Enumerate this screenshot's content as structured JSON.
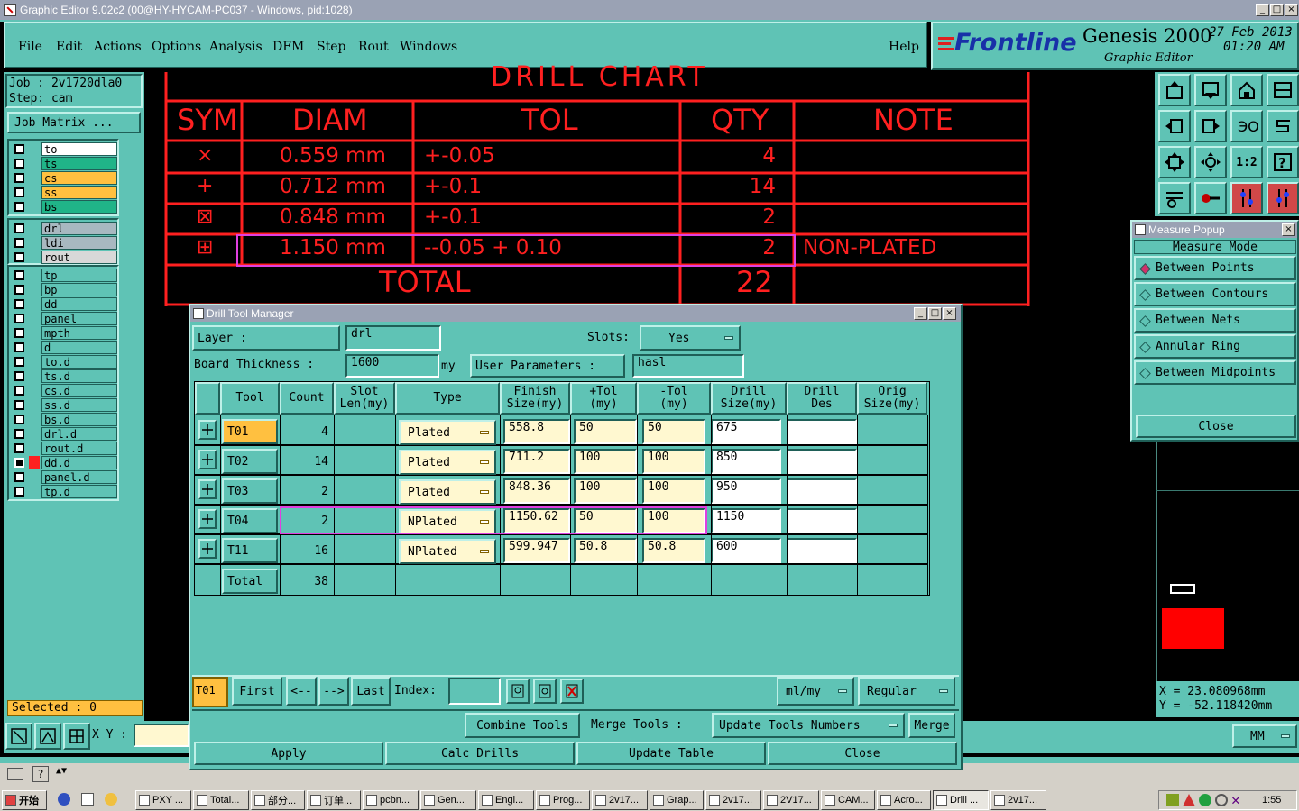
{
  "window": {
    "title": "Graphic Editor 9.02c2 (00@HY-HYCAM-PC037 - Windows, pid:1028)"
  },
  "menu": [
    "File",
    "Edit",
    "Actions",
    "Options",
    "Analysis",
    "DFM",
    "Step",
    "Rout",
    "Windows"
  ],
  "help": "Help",
  "brand": {
    "logo": "Frontline",
    "product": "Genesis 2000",
    "subtitle": "Graphic Editor",
    "date": "27 Feb 2013",
    "time": "01:20 AM"
  },
  "job": {
    "job_label": "Job : 2v1720dla0",
    "step_label": "Step: cam",
    "matrix_button": "Job Matrix ..."
  },
  "layers": {
    "group1": [
      {
        "name": "to",
        "color": "#ffffff"
      },
      {
        "name": "ts",
        "color": "#20b488"
      },
      {
        "name": "cs",
        "color": "#ffc040"
      },
      {
        "name": "ss",
        "color": "#ffc040"
      },
      {
        "name": "bs",
        "color": "#20b488"
      }
    ],
    "group2": [
      {
        "name": "drl",
        "color": "#a8b8c0"
      },
      {
        "name": "ldi",
        "color": "#a8b8c0"
      },
      {
        "name": "rout",
        "color": "#d8d8d8"
      }
    ],
    "group3": [
      {
        "name": "tp"
      },
      {
        "name": "bp"
      },
      {
        "name": "dd"
      },
      {
        "name": "panel"
      },
      {
        "name": "mpth"
      },
      {
        "name": "d"
      },
      {
        "name": "to.d"
      },
      {
        "name": "ts.d"
      },
      {
        "name": "cs.d"
      },
      {
        "name": "ss.d"
      },
      {
        "name": "bs.d"
      },
      {
        "name": "drl.d"
      },
      {
        "name": "rout.d"
      },
      {
        "name": "dd.d"
      },
      {
        "name": "panel.d"
      },
      {
        "name": "tp.d"
      }
    ],
    "selected_label": "Selected : 0"
  },
  "drill_chart": {
    "title": "DRILL CHART",
    "headers": [
      "SYM",
      "DIAM",
      "TOL",
      "QTY",
      "NOTE"
    ],
    "rows": [
      {
        "sym": "×",
        "diam": "0.559 mm",
        "tol": "+-0.05",
        "qty": "4",
        "note": ""
      },
      {
        "sym": "+",
        "diam": "0.712 mm",
        "tol": "+-0.1",
        "qty": "14",
        "note": ""
      },
      {
        "sym": "⊠",
        "diam": "0.848 mm",
        "tol": "+-0.1",
        "qty": "2",
        "note": ""
      },
      {
        "sym": "⊞",
        "diam": "1.150 mm",
        "tol": "--0.05 + 0.10",
        "qty": "2",
        "note": "NON-PLATED"
      }
    ],
    "total_label": "TOTAL",
    "total_qty": "22"
  },
  "measure_popup": {
    "title": "Measure Popup",
    "mode_label": "Measure Mode",
    "options": [
      {
        "label": "Between Points",
        "selected": true
      },
      {
        "label": "Between Contours",
        "selected": false
      },
      {
        "label": "Between Nets",
        "selected": false
      },
      {
        "label": "Annular Ring",
        "selected": false
      },
      {
        "label": "Between Midpoints",
        "selected": false
      }
    ],
    "close": "Close"
  },
  "coords": {
    "x": "X  = 23.080968mm",
    "y": "Y  = -52.118420mm"
  },
  "dtm": {
    "title": "Drill Tool Manager",
    "layer_label": "Layer          :",
    "layer_value": "drl",
    "slots_label": "Slots:",
    "slots_value": "Yes",
    "thickness_label": "Board Thickness :",
    "thickness_value": "1600",
    "thickness_unit": "my",
    "user_params_label": "User Parameters :",
    "user_params_value": "hasl",
    "columns": [
      {
        "id": "tool",
        "label": "Tool"
      },
      {
        "id": "count",
        "label": "Count"
      },
      {
        "id": "slot",
        "label": "Slot\nLen(my)"
      },
      {
        "id": "type",
        "label": "Type"
      },
      {
        "id": "finish",
        "label": "Finish\nSize(my)"
      },
      {
        "id": "ptol",
        "label": "+Tol\n(my)"
      },
      {
        "id": "mtol",
        "label": "-Tol\n(my)"
      },
      {
        "id": "drill",
        "label": "Drill\nSize(my)"
      },
      {
        "id": "des",
        "label": "Drill\nDes"
      },
      {
        "id": "orig",
        "label": "Orig\nSize(my)"
      }
    ],
    "rows": [
      {
        "tool": "T01",
        "count": "4",
        "type": "Plated",
        "finish": "558.8",
        "ptol": "50",
        "mtol": "50",
        "drill": "675",
        "des": ""
      },
      {
        "tool": "T02",
        "count": "14",
        "type": "Plated",
        "finish": "711.2",
        "ptol": "100",
        "mtol": "100",
        "drill": "850",
        "des": ""
      },
      {
        "tool": "T03",
        "count": "2",
        "type": "Plated",
        "finish": "848.36",
        "ptol": "100",
        "mtol": "100",
        "drill": "950",
        "des": ""
      },
      {
        "tool": "T04",
        "count": "2",
        "type": "NPlated",
        "finish": "1150.62",
        "ptol": "50",
        "mtol": "100",
        "drill": "1150",
        "des": ""
      },
      {
        "tool": "T11",
        "count": "16",
        "type": "NPlated",
        "finish": "599.947",
        "ptol": "50.8",
        "mtol": "50.8",
        "drill": "600",
        "des": ""
      }
    ],
    "total_label": "Total",
    "total_count": "38",
    "nav": {
      "current": "T01",
      "first": "First",
      "prev": "<--",
      "next": "-->",
      "last": "Last",
      "index_label": "Index:",
      "units": "ml/my",
      "mode": "Regular"
    },
    "actions": {
      "combine": "Combine Tools",
      "merge_label": "Merge Tools :",
      "update_numbers": "Update Tools Numbers",
      "merge": "Merge"
    },
    "footer": {
      "apply": "Apply",
      "calc": "Calc Drills",
      "update_table": "Update Table",
      "close": "Close"
    }
  },
  "bottom": {
    "xy_label": "X Y :",
    "units": "MM"
  },
  "taskbar": {
    "start": "开始",
    "tasks": [
      "PXY ...",
      "Total...",
      "部分...",
      "订单...",
      "pcbn...",
      "Gen...",
      "Engi...",
      "Prog...",
      "2v17...",
      "Grap...",
      "2v17...",
      "2V17...",
      "CAM...",
      "Acro...",
      "Drill ...",
      "2v17..."
    ],
    "clock": "1:55"
  }
}
